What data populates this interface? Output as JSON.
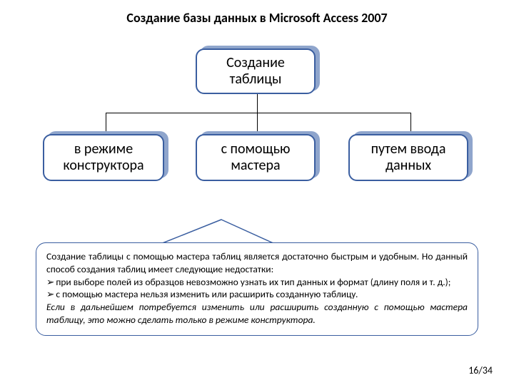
{
  "title": "Создание базы данных в Microsoft Access 2007",
  "diagram": {
    "root": "Создание таблицы",
    "children": [
      "в режиме конструктора",
      "с помощью мастера",
      "путем ввода данных"
    ]
  },
  "callout": {
    "intro": "Создание таблицы с помощью мастера таблиц является достаточно быстрым и удобным. Но данный способ создания таблиц имеет следующие недостатки:",
    "bullets": [
      "при выборе полей из образцов невозможно узнать их тип данных и формат (длину поля и т. д.);",
      "с помощью мастера нельзя изменить или расширить созданную таблицу."
    ],
    "note": "Если в дальнейшем потребуется изменить или расширить созданную с помощью мастера таблицу, это можно сделать только в режиме конструктора."
  },
  "page": "16/34",
  "bullet_glyph": "➢"
}
